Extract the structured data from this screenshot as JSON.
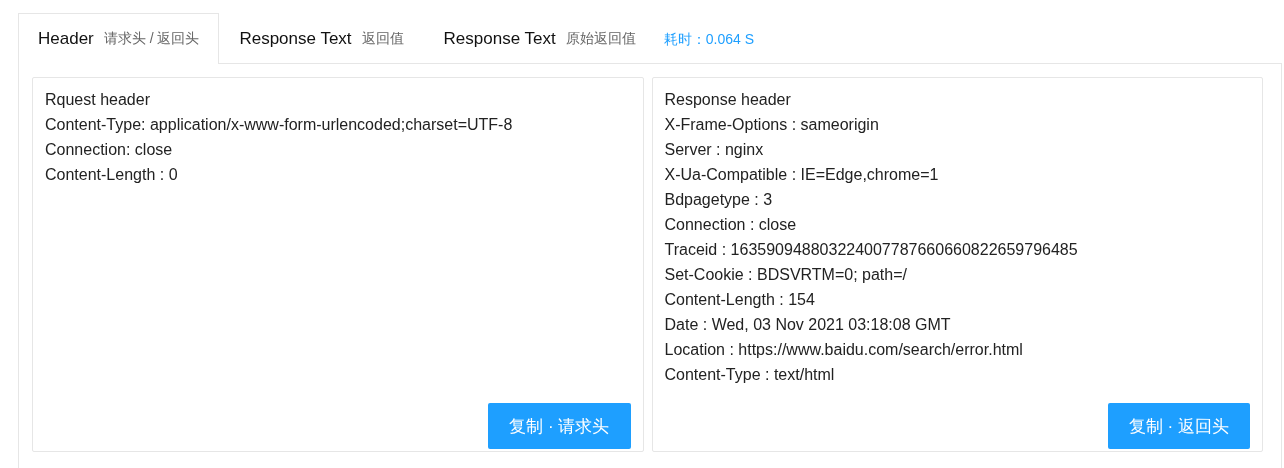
{
  "tabs": [
    {
      "label": "Header",
      "sublabel": "请求头 / 返回头",
      "selected": true
    },
    {
      "label": "Response Text",
      "sublabel": "返回值",
      "selected": false
    },
    {
      "label": "Response Text",
      "sublabel": "原始返回值",
      "selected": false
    }
  ],
  "elapsed": "耗时：0.064 S",
  "panels": [
    {
      "lines": [
        "Rquest header",
        "Content-Type: application/x-www-form-urlencoded;charset=UTF-8",
        "Connection: close",
        "Content-Length : 0"
      ],
      "button": "复制 · 请求头"
    },
    {
      "lines": [
        "Response header",
        "X-Frame-Options : sameorigin",
        "Server : nginx",
        "X-Ua-Compatible : IE=Edge,chrome=1",
        "Bdpagetype : 3",
        "Connection : close",
        "Traceid : 163590948803224007787660660822659796485",
        "Set-Cookie : BDSVRTM=0; path=/",
        "Content-Length : 154",
        "Date : Wed, 03 Nov 2021 03:18:08 GMT",
        "Location : https://www.baidu.com/search/error.html",
        "Content-Type : text/html"
      ],
      "button": "复制 · 返回头"
    }
  ]
}
